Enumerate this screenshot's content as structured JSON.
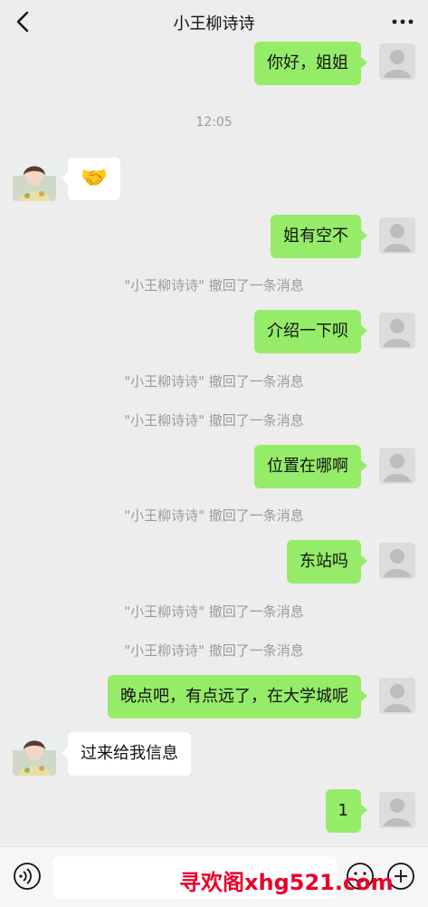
{
  "header": {
    "title": "小王柳诗诗",
    "back_icon": "chevron-left-icon",
    "more_icon": "more-dots-icon"
  },
  "messages": {
    "m1": "你好，姐姐",
    "time1": "12:05",
    "m2_emoji": "🤝",
    "m3": "姐有空不",
    "recall1": "\"小王柳诗诗\" 撤回了一条消息",
    "m4": "介绍一下呗",
    "recall2": "\"小王柳诗诗\" 撤回了一条消息",
    "recall3": "\"小王柳诗诗\" 撤回了一条消息",
    "m5": "位置在哪啊",
    "recall4": "\"小王柳诗诗\" 撤回了一条消息",
    "m6": "东站吗",
    "recall5": "\"小王柳诗诗\" 撤回了一条消息",
    "recall6": "\"小王柳诗诗\" 撤回了一条消息",
    "m7": "晚点吧，有点远了，在大学城呢",
    "m8": "过来给我信息",
    "m9": "1"
  },
  "bottom": {
    "voice_icon": "voice-icon",
    "emoji_icon": "emoji-icon",
    "plus_icon": "plus-icon",
    "input_value": ""
  },
  "watermark": "寻欢阁xhg521.com",
  "colors": {
    "background": "#ededed",
    "my_bubble": "#95ec69",
    "other_bubble": "#ffffff",
    "system_text": "#9a9a9a",
    "watermark": "#e8002a"
  }
}
